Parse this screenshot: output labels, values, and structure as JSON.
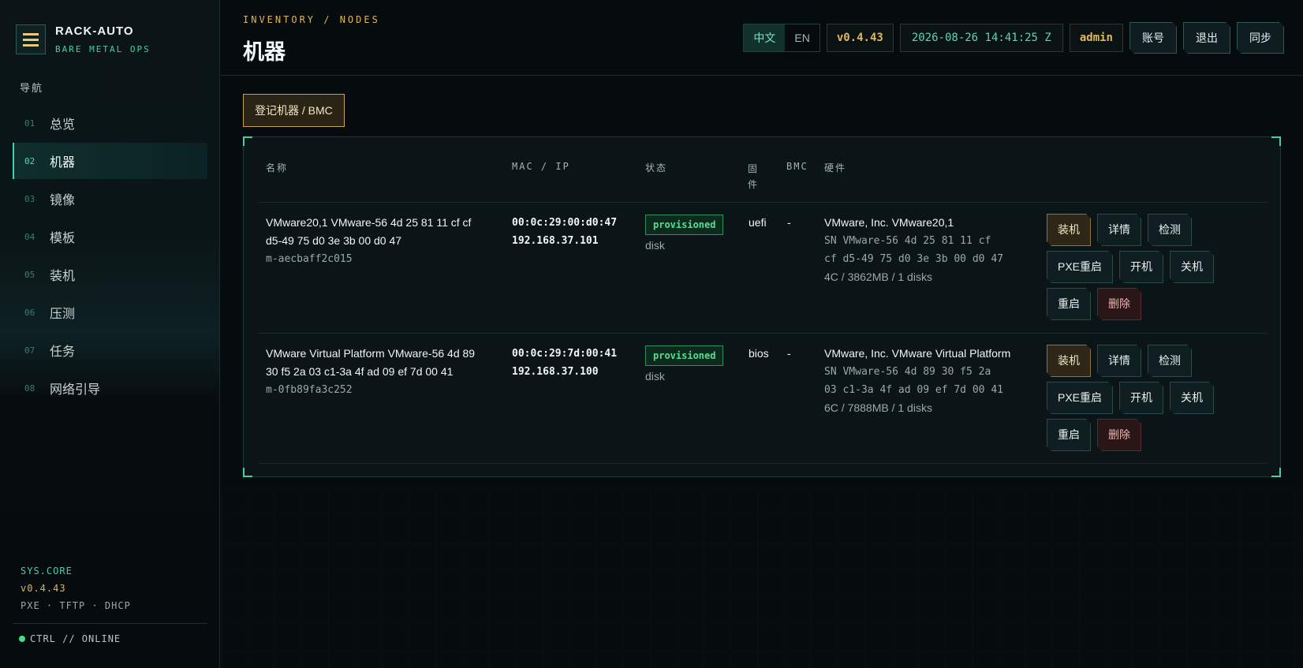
{
  "brand": {
    "name": "RACK-AUTO",
    "subtitle": "BARE METAL OPS"
  },
  "nav": {
    "title": "导航",
    "items": [
      {
        "num": "01",
        "label": "总览"
      },
      {
        "num": "02",
        "label": "机器"
      },
      {
        "num": "03",
        "label": "镜像"
      },
      {
        "num": "04",
        "label": "模板"
      },
      {
        "num": "05",
        "label": "装机"
      },
      {
        "num": "06",
        "label": "压测"
      },
      {
        "num": "07",
        "label": "任务"
      },
      {
        "num": "08",
        "label": "网络引导"
      }
    ],
    "active_index": 1
  },
  "sys": {
    "core": "SYS.CORE",
    "version": "v0.4.43",
    "services": "PXE · TFTP · DHCP",
    "status": "CTRL // ONLINE"
  },
  "header": {
    "breadcrumb": "INVENTORY / NODES",
    "title": "机器",
    "lang_zh": "中文",
    "lang_en": "EN",
    "version": "v0.4.43",
    "time": "2026-08-26 14:41:25 Z",
    "user": "admin",
    "account_label": "账号",
    "logout_label": "退出",
    "sync_label": "同步"
  },
  "main": {
    "register_label": "登记机器 / BMC",
    "columns": {
      "name": "名称",
      "mac_ip": "MAC / IP",
      "status": "状态",
      "firmware": "固件",
      "bmc": "BMC",
      "hardware": "硬件"
    },
    "rows": [
      {
        "name": "VMware20,1 VMware-56 4d 25 81 11 cf cf d5-49 75 d0 3e 3b 00 d0 47",
        "name_line1": "VMware20,1 VMware-56 4d 25 81 11 cf cf",
        "name_line2": "d5-49 75 d0 3e 3b 00 d0 47",
        "id": "m-aecbaff2c015",
        "mac": "00:0c:29:00:d0:47",
        "ip": "192.168.37.101",
        "status": "provisioned",
        "boot": "disk",
        "firmware": "uefi",
        "bmc": "-",
        "hw_vendor": "VMware, Inc. VMware20,1",
        "hw_sn_line1": "SN VMware-56 4d 25 81 11 cf",
        "hw_sn_line2": "cf d5-49 75 d0 3e 3b 00 d0 47",
        "hw_spec": "4C / 3862MB / 1 disks"
      },
      {
        "name": "VMware Virtual Platform VMware-56 4d 89 30 f5 2a 03 c1-3a 4f ad 09 ef 7d 00 41",
        "name_line1": "VMware Virtual Platform VMware-56 4d 89",
        "name_line2": "30 f5 2a 03 c1-3a 4f ad 09 ef 7d 00 41",
        "id": "m-0fb89fa3c252",
        "mac": "00:0c:29:7d:00:41",
        "ip": "192.168.37.100",
        "status": "provisioned",
        "boot": "disk",
        "firmware": "bios",
        "bmc": "-",
        "hw_vendor": "VMware, Inc. VMware Virtual Platform",
        "hw_sn_line1": "SN VMware-56 4d 89 30 f5 2a",
        "hw_sn_line2": "03 c1-3a 4f ad 09 ef 7d 00 41",
        "hw_spec": "6C / 7888MB / 1 disks"
      }
    ],
    "actions": {
      "install": "装机",
      "details": "详情",
      "detect": "检测",
      "pxe_reboot": "PXE重启",
      "power_on": "开机",
      "power_off": "关机",
      "reboot": "重启",
      "delete": "删除"
    }
  },
  "colors": {
    "accent": "#3fd1a8",
    "gold": "#e0b65a",
    "ok": "#53e08f",
    "danger": "#f0b3b3"
  },
  "icons": {
    "menu": "hamburger-menu-icon",
    "status": "online-dot-icon"
  }
}
